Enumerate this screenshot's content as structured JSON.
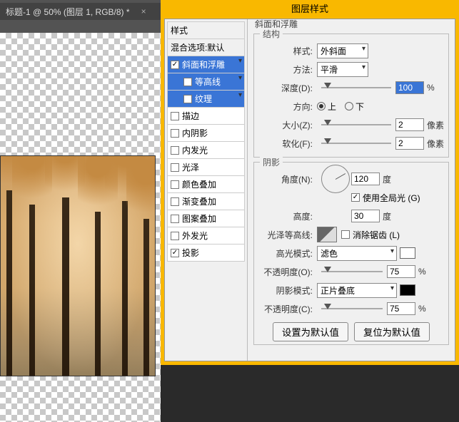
{
  "tab": {
    "title": "标题-1 @ 50% (图层 1, RGB/8) *",
    "close": "×"
  },
  "dialog": {
    "title": "图层样式"
  },
  "stylelist": {
    "header": "样式",
    "blend": "混合选项:默认",
    "items": [
      {
        "label": "斜面和浮雕",
        "checked": true,
        "selected": true
      },
      {
        "label": "等高线",
        "checked": false,
        "sub": true,
        "selected": true
      },
      {
        "label": "纹理",
        "checked": false,
        "sub": true,
        "selected": true
      },
      {
        "label": "描边",
        "checked": false
      },
      {
        "label": "内阴影",
        "checked": false
      },
      {
        "label": "内发光",
        "checked": false
      },
      {
        "label": "光泽",
        "checked": false
      },
      {
        "label": "颜色叠加",
        "checked": false
      },
      {
        "label": "渐变叠加",
        "checked": false
      },
      {
        "label": "图案叠加",
        "checked": false
      },
      {
        "label": "外发光",
        "checked": false
      },
      {
        "label": "投影",
        "checked": true
      }
    ]
  },
  "bevel": {
    "section": "斜面和浮雕",
    "structure": {
      "title": "结构",
      "style_label": "样式:",
      "style_value": "外斜面",
      "technique_label": "方法:",
      "technique_value": "平滑",
      "depth_label": "深度(D):",
      "depth_value": "100",
      "depth_unit": "%",
      "direction_label": "方向:",
      "up": "上",
      "down": "下",
      "size_label": "大小(Z):",
      "size_value": "2",
      "size_unit": "像素",
      "soften_label": "软化(F):",
      "soften_value": "2",
      "soften_unit": "像素"
    },
    "shading": {
      "title": "阴影",
      "angle_label": "角度(N):",
      "angle_value": "120",
      "angle_unit": "度",
      "global_label": "使用全局光 (G)",
      "altitude_label": "高度:",
      "altitude_value": "30",
      "altitude_unit": "度",
      "gloss_label": "光泽等高线:",
      "aa_label": "消除锯齿 (L)",
      "highlight_mode_label": "高光模式:",
      "highlight_mode_value": "滤色",
      "highlight_op_label": "不透明度(O):",
      "highlight_op_value": "75",
      "highlight_op_unit": "%",
      "shadow_mode_label": "阴影模式:",
      "shadow_mode_value": "正片叠底",
      "shadow_op_label": "不透明度(C):",
      "shadow_op_value": "75",
      "shadow_op_unit": "%"
    }
  },
  "buttons": {
    "make_default": "设置为默认值",
    "reset_default": "复位为默认值"
  }
}
